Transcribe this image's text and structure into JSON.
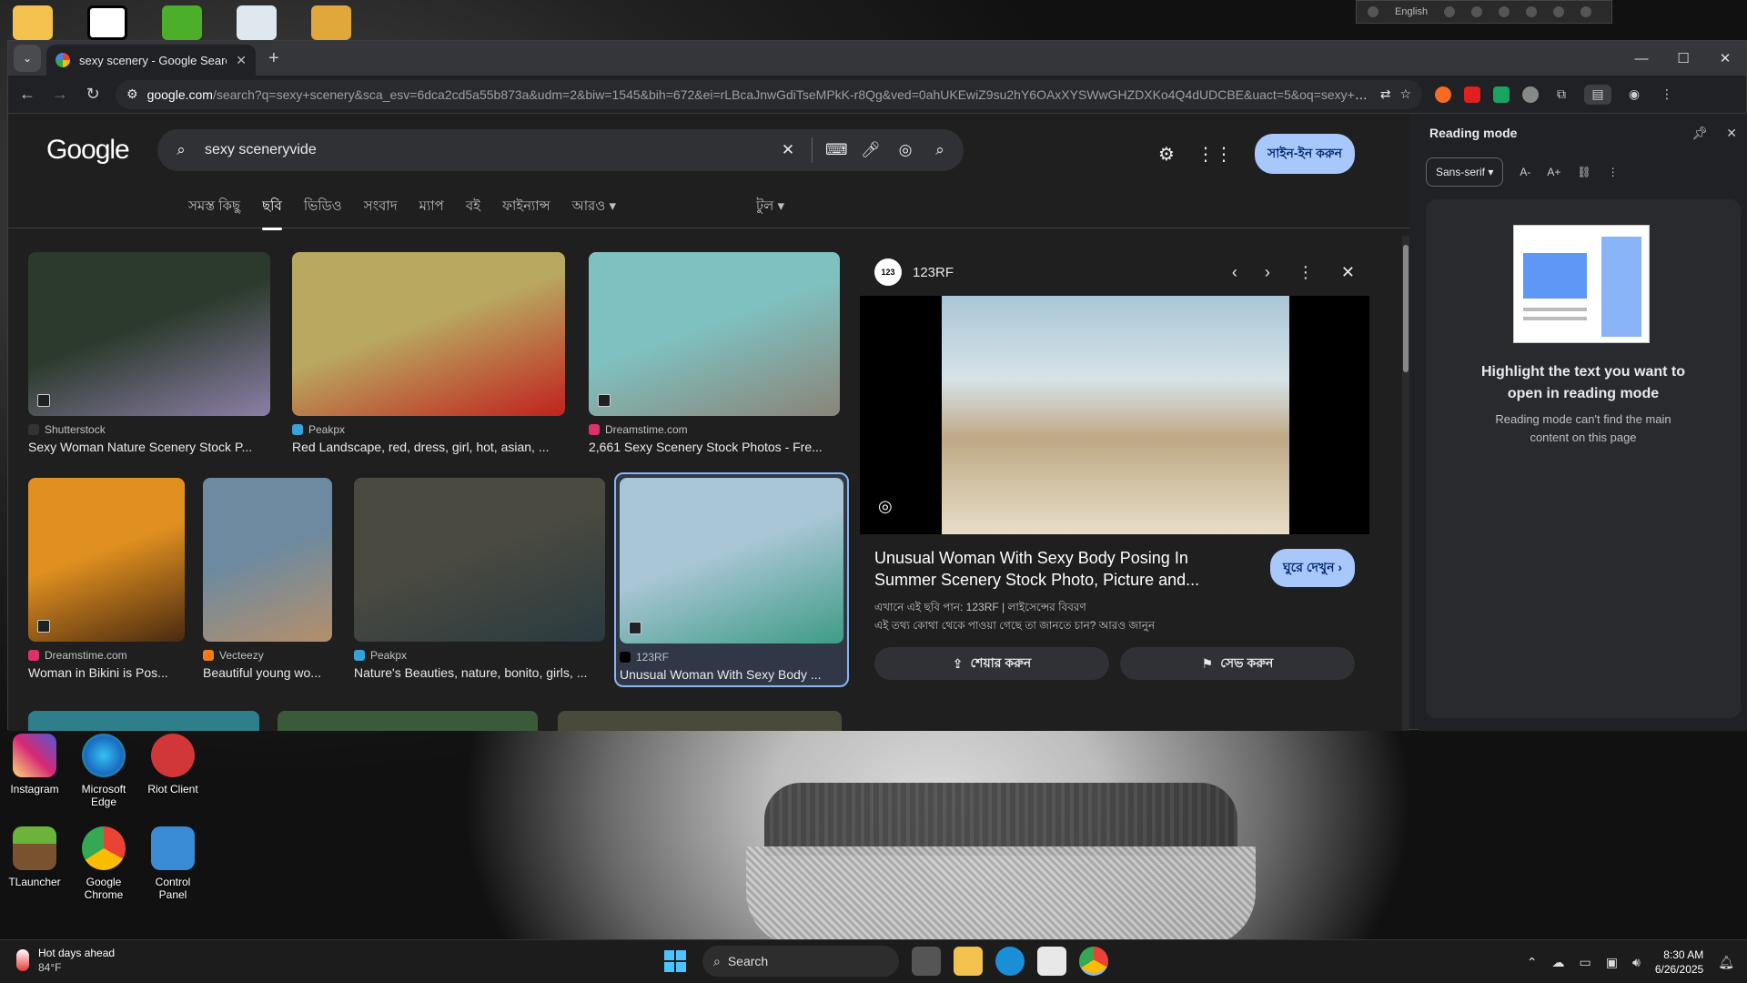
{
  "desktop": {
    "top_icons": [
      "folder-icon",
      "capcut-icon",
      "green-app-icon",
      "recycle-bin-icon",
      "winrar-icon"
    ],
    "icons": [
      {
        "label": "Instagram",
        "color": "#d6249f"
      },
      {
        "label": "Microsoft Edge",
        "color": "#0c9bd7"
      },
      {
        "label": "Riot Client",
        "color": "#d13639"
      },
      {
        "label": "TLauncher",
        "color": "#5a8f2c"
      },
      {
        "label": "Google Chrome",
        "color": "#4285f4"
      },
      {
        "label": "Control Panel",
        "color": "#3a8bd6"
      }
    ]
  },
  "langbar": {
    "label": "English"
  },
  "browser": {
    "tab_title": "sexy scenery - Google Search",
    "url_host": "google.com",
    "url_rest": "/search?q=sexy+scenery&sca_esv=6dca2cd5a55b873a&udm=2&biw=1545&bih=672&ei=rLBcaJnwGdiTseMPkK-r8Qg&ved=0ahUKEwiZ9su2hY6OAxXYSWwGHZDXKo4Q4dUDCBE&uact=5&oq=sexy+scenery..."
  },
  "google": {
    "logo": "Google",
    "query": "sexy sceneryvide",
    "signin": "সাইন-ইন করুন",
    "tabs": [
      "সমস্ত কিছু",
      "ছবি",
      "ভিডিও",
      "সংবাদ",
      "ম্যাপ",
      "বই",
      "ফাইন্যান্স",
      "আরও"
    ],
    "tools": "টুল"
  },
  "results": [
    {
      "source": "Shutterstock",
      "title": "Sexy Woman Nature Scenery Stock P...",
      "c1": "#2b3a2c",
      "c2": "#8c7ea6",
      "fav": "#333"
    },
    {
      "source": "Peakpx",
      "title": "Red Landscape, red, dress, girl, hot, asian, ...",
      "c1": "#b9a860",
      "c2": "#c0221d",
      "fav": "#3aa0d8"
    },
    {
      "source": "Dreamstime.com",
      "title": "2,661 Sexy Scenery Stock Photos - Fre...",
      "c1": "#7fc1c0",
      "c2": "#8a8478",
      "fav": "#e0306a"
    },
    {
      "source": "Dreamstime.com",
      "title": "Woman in Bikini is Pos...",
      "c1": "#e09020",
      "c2": "#4a2a10",
      "fav": "#e0306a"
    },
    {
      "source": "Vecteezy",
      "title": "Beautiful young wo...",
      "c1": "#6d8aa0",
      "c2": "#b58f6a",
      "fav": "#f07d1a"
    },
    {
      "source": "Peakpx",
      "title": "Nature's Beauties, nature, bonito, girls, ...",
      "c1": "#4a4a40",
      "c2": "#2a3a40",
      "fav": "#3aa0d8"
    },
    {
      "source": "123RF",
      "title": "Unusual Woman With Sexy Body ...",
      "c1": "#a9c6d6",
      "c2": "#3e9c86",
      "fav": "#000"
    }
  ],
  "preview": {
    "site": "123RF",
    "logo_text": "123",
    "title": "Unusual Woman With Sexy Body Posing In Summer Scenery Stock Photo, Picture and...",
    "visit": "ঘুরে দেখুন",
    "license_line": "এখানে এই ছবি পান: 123RF | লাইসেন্সের বিবরণ",
    "info_line": "এই তথ্য কোথা থেকে পাওয়া গেছে তা জানতে চান? আরও জানুন",
    "share": "শেয়ার করুন",
    "save": "সেভ করুন"
  },
  "reading_mode": {
    "title": "Reading mode",
    "font": "Sans-serif",
    "size_down": "A-",
    "size_up": "A+",
    "headline": "Highlight the text you want to open in reading mode",
    "subtext": "Reading mode can't find the main content on this page"
  },
  "taskbar": {
    "weather_title": "Hot days ahead",
    "weather_temp": "84°F",
    "search": "Search",
    "time": "8:30 AM",
    "date": "6/26/2025"
  }
}
